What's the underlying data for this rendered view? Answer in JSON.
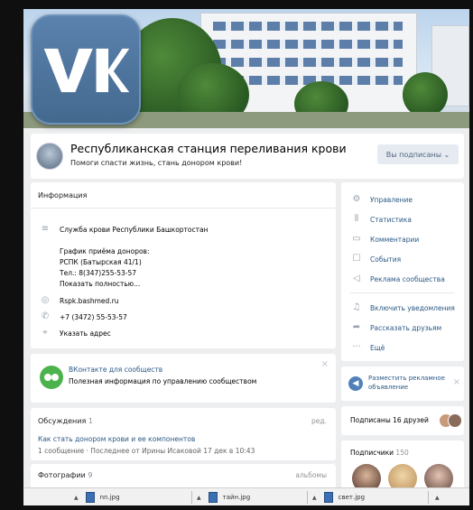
{
  "logo": {
    "text": "VK"
  },
  "group": {
    "title": "Республиканская станция переливания крови",
    "status": "Помоги спасти жизнь, стань донором крови!",
    "subscribe_button": "Вы подписаны ⌄"
  },
  "info": {
    "title": "Информация",
    "description_lines": [
      "Служба крови Республики Башкортостан",
      "",
      "График приёма доноров:",
      "РСПК (Батырская 41/1)",
      "Тел.: 8(347)255-53-57"
    ],
    "show_more": "Показать полностью...",
    "website": "Rspk.bashmed.ru",
    "phone": "+7 (3472) 55-53-57",
    "address": "Указать адрес"
  },
  "apps": {
    "title": "ВКонтакте для сообществ",
    "description": "Полезная информация по управлению сообществом"
  },
  "discussions": {
    "title": "Обсуждения",
    "count": "1",
    "edit": "ред.",
    "topic_title": "Как стать донором крови и ее компонентов",
    "topic_meta": "1 сообщение · Последнее от Ирины Исаковой 17 дек в 10:43"
  },
  "photos": {
    "title": "Фотографии",
    "count": "9",
    "albums": "альбомы"
  },
  "menu": {
    "items": [
      {
        "label": "Управление",
        "icon": "gear-icon"
      },
      {
        "label": "Статистика",
        "icon": "stats-icon"
      },
      {
        "label": "Комментарии",
        "icon": "comment-icon"
      },
      {
        "label": "События",
        "icon": "event-icon"
      },
      {
        "label": "Реклама сообщества",
        "icon": "megaphone-icon"
      },
      {
        "label": "Включить уведомления",
        "icon": "bell-icon"
      },
      {
        "label": "Рассказать друзьям",
        "icon": "share-icon"
      },
      {
        "label": "Ещё",
        "icon": "more-icon"
      }
    ]
  },
  "ad": {
    "label": "Разместить рекламное объявление"
  },
  "friends": {
    "label": "Подписаны 16 друзей"
  },
  "subscribers": {
    "title": "Подписчики",
    "count": "150"
  },
  "downloads": {
    "items": [
      {
        "name": "nn.jpg"
      },
      {
        "name": "тайн.jpg"
      },
      {
        "name": "свет.jpg"
      }
    ]
  }
}
